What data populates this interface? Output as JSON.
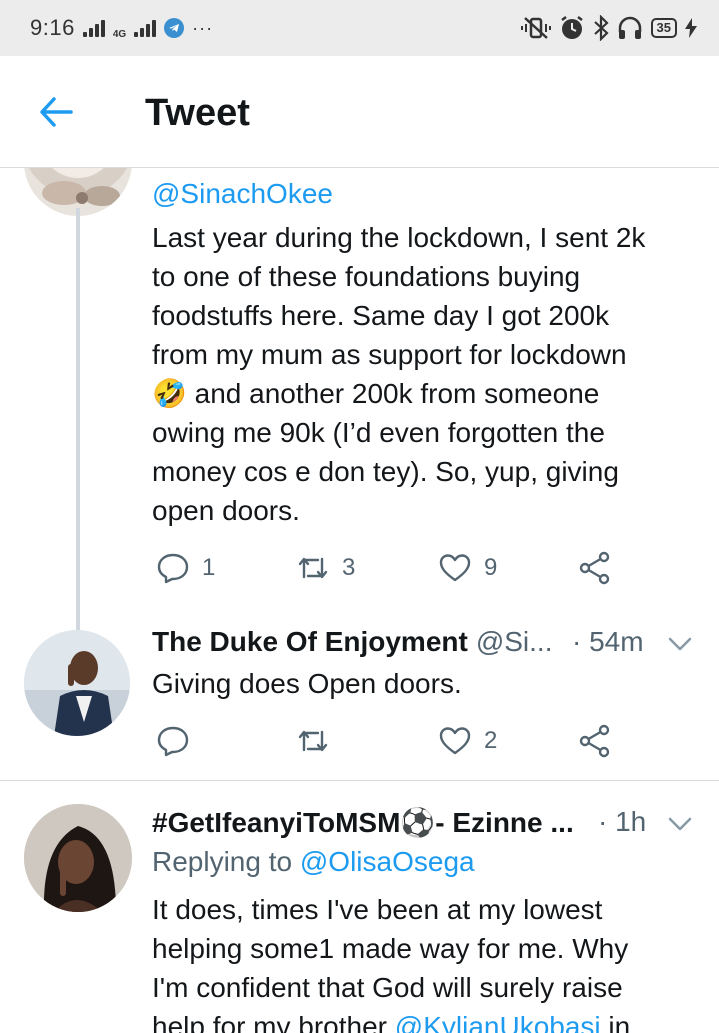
{
  "status_bar": {
    "time": "9:16",
    "network_label": "4G",
    "overflow": "···",
    "battery": "35"
  },
  "header": {
    "title": "Tweet"
  },
  "tweets": [
    {
      "handle": "@SinachOkee",
      "lines": [
        "Last year during the lockdown, I sent 2k",
        "to one of these foundations buying",
        "foodstuffs here. Same day I got 200k",
        "from my mum as support for lockdown",
        "🤣 and another 200k from someone",
        "owing me 90k (I’d even forgotten the",
        "money cos e don tey). So, yup, giving",
        "open doors."
      ],
      "replies": "1",
      "retweets": "3",
      "likes": "9"
    },
    {
      "name": "The Duke Of Enjoyment",
      "handle": "@Si...",
      "time": "· 54m",
      "text": "Giving does Open doors.",
      "likes": "2"
    },
    {
      "name": "#GetIfeanyiToMSM⚽- Ezinne ...",
      "time": "· 1h",
      "replying_prefix": "Replying to ",
      "replying_handle": "@OlisaOsega",
      "lines": [
        "It does, times I've been at my lowest",
        "helping some1 made way for me. Why",
        "I'm confident that God will surely raise"
      ],
      "last_line_prefix": "help for my brother ",
      "last_line_mention": "@KylianUkobasi",
      "last_line_suffix": " in"
    }
  ],
  "colors": {
    "accent": "#1d9bf0",
    "secondary_text": "#536471",
    "status_bar_bg": "#ececec"
  }
}
